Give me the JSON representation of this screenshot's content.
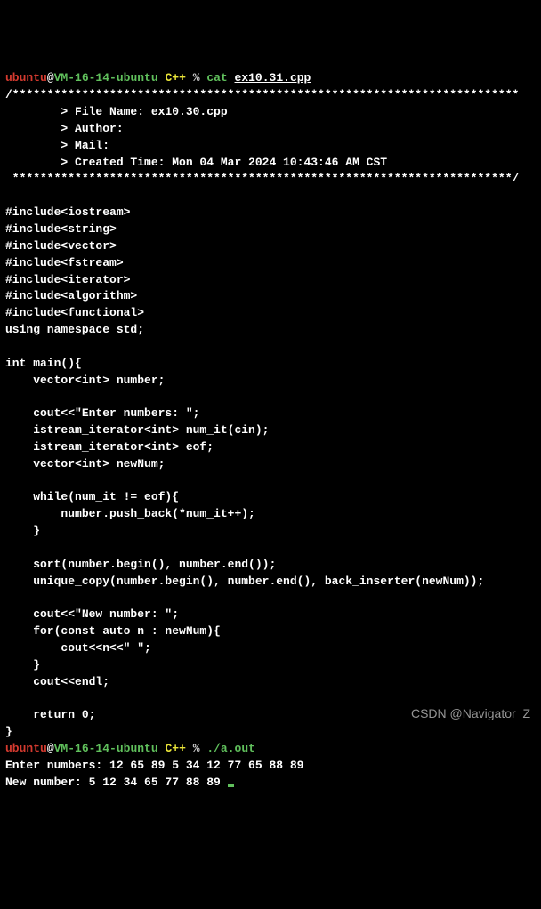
{
  "prompt1": {
    "user": "ubuntu",
    "at": "@",
    "host": "VM-16-14-ubuntu",
    "dir": "C++",
    "pct": "%",
    "cmd": "cat",
    "arg": "ex10.31.cpp"
  },
  "header": {
    "top": "/*************************************************************************",
    "file": "        > File Name: ex10.30.cpp",
    "author": "        > Author:",
    "mail": "        > Mail:",
    "time": "        > Created Time: Mon 04 Mar 2024 10:43:46 AM CST",
    "bot": " ************************************************************************/"
  },
  "code": [
    "",
    "#include<iostream>",
    "#include<string>",
    "#include<vector>",
    "#include<fstream>",
    "#include<iterator>",
    "#include<algorithm>",
    "#include<functional>",
    "using namespace std;",
    "",
    "int main(){",
    "    vector<int> number;",
    "",
    "    cout<<\"Enter numbers: \";",
    "    istream_iterator<int> num_it(cin);",
    "    istream_iterator<int> eof;",
    "    vector<int> newNum;",
    "",
    "    while(num_it != eof){",
    "        number.push_back(*num_it++);",
    "    }",
    "",
    "    sort(number.begin(), number.end());",
    "    unique_copy(number.begin(), number.end(), back_inserter(newNum));",
    "",
    "    cout<<\"New number: \";",
    "    for(const auto n : newNum){",
    "        cout<<n<<\" \";",
    "    }",
    "    cout<<endl;",
    "",
    "    return 0;",
    "}"
  ],
  "prompt2": {
    "user": "ubuntu",
    "at": "@",
    "host": "VM-16-14-ubuntu",
    "dir": "C++",
    "pct": "%",
    "cmd": "./a.out"
  },
  "output": {
    "enter": "Enter numbers: 12 65 89 5 34 12 77 65 88 89",
    "new": "New number: 5 12 34 65 77 88 89"
  },
  "watermark": "CSDN @Navigator_Z"
}
